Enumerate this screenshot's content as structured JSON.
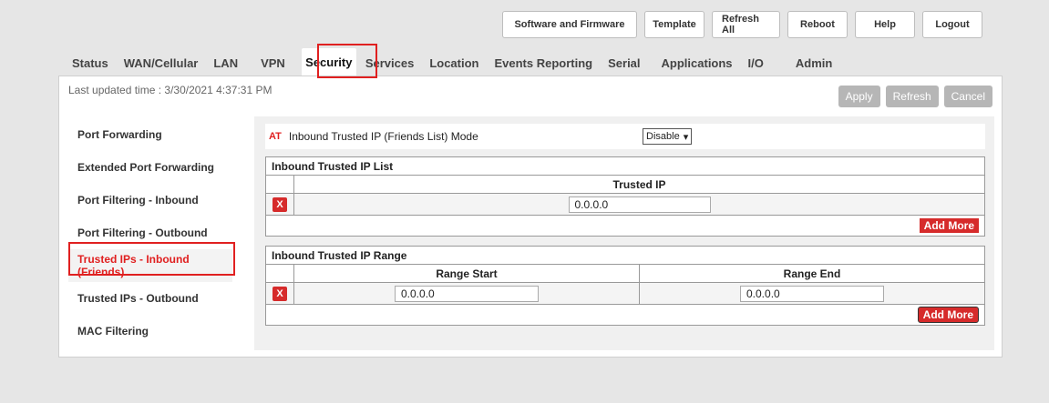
{
  "top_buttons": [
    "Software and Firmware",
    "Template",
    "Refresh All",
    "Reboot",
    "Help",
    "Logout"
  ],
  "tabs": [
    {
      "label": "Status"
    },
    {
      "label": "WAN/Cellular"
    },
    {
      "label": "LAN"
    },
    {
      "label": "VPN"
    },
    {
      "label": "Security"
    },
    {
      "label": "Services"
    },
    {
      "label": "Location"
    },
    {
      "label": "Events Reporting"
    },
    {
      "label": "Serial"
    },
    {
      "label": "Applications"
    },
    {
      "label": "I/O"
    },
    {
      "label": "Admin"
    }
  ],
  "active_tab": "Security",
  "last_updated": "Last updated time : 3/30/2021 4:37:31 PM",
  "actions": {
    "apply": "Apply",
    "refresh": "Refresh",
    "cancel": "Cancel"
  },
  "sidebar": [
    {
      "label": "Port Forwarding"
    },
    {
      "label": "Extended Port Forwarding"
    },
    {
      "label": "Port Filtering - Inbound"
    },
    {
      "label": "Port Filtering - Outbound"
    },
    {
      "label": "Trusted IPs - Inbound (Friends)"
    },
    {
      "label": "Trusted IPs - Outbound"
    },
    {
      "label": "MAC Filtering"
    }
  ],
  "active_sidebar": "Trusted IPs - Inbound (Friends)",
  "mode": {
    "badge": "AT",
    "label": "Inbound Trusted IP (Friends List) Mode",
    "value": "Disable"
  },
  "trusted_ip_list": {
    "title": "Inbound Trusted IP List",
    "column": "Trusted IP",
    "rows": [
      {
        "delete": "X",
        "ip": "0.0.0.0"
      }
    ],
    "add_more": "Add More"
  },
  "trusted_ip_range": {
    "title": "Inbound Trusted IP Range",
    "columns": [
      "Range Start",
      "Range End"
    ],
    "rows": [
      {
        "delete": "X",
        "start": "0.0.0.0",
        "end": "0.0.0.0"
      }
    ],
    "add_more": "Add More"
  },
  "colors": {
    "accent_red": "#d62b2b",
    "highlight_red": "#e02020"
  }
}
